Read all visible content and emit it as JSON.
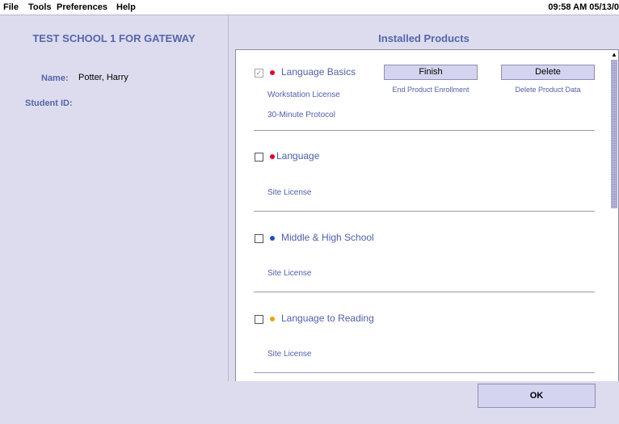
{
  "menubar": {
    "items": [
      "File",
      "Tools",
      "Preferences",
      "Help"
    ],
    "clock": "09:58 AM 05/13/0"
  },
  "left": {
    "school": "TEST SCHOOL 1 FOR GATEWAY",
    "name_label": "Name:",
    "name_value": "Potter, Harry",
    "student_id_label": "Student ID:"
  },
  "right": {
    "title": "Installed Products",
    "products": [
      {
        "name": "Language Basics",
        "checked": true,
        "dot_color": "#e0002a",
        "lines": [
          "Workstation License",
          "30-Minute Protocol"
        ],
        "finish_label": "Finish",
        "finish_caption": "End Product Enrollment",
        "delete_label": "Delete",
        "delete_caption": "Delete Product Data"
      },
      {
        "name": "Language",
        "checked": false,
        "dot_color": "#e0002a",
        "lines": [
          "Site License"
        ]
      },
      {
        "name": "Middle & High School",
        "checked": false,
        "dot_color": "#1f4fc0",
        "lines": [
          "Site License"
        ]
      },
      {
        "name": "Language to Reading",
        "checked": false,
        "dot_color": "#f0a010",
        "lines": [
          "Site License"
        ]
      }
    ]
  },
  "footer": {
    "ok_label": "OK"
  },
  "icons": {
    "scroll_up": "arrow-up-icon",
    "scroll_down": "arrow-down-icon",
    "check": "checkmark-icon"
  }
}
